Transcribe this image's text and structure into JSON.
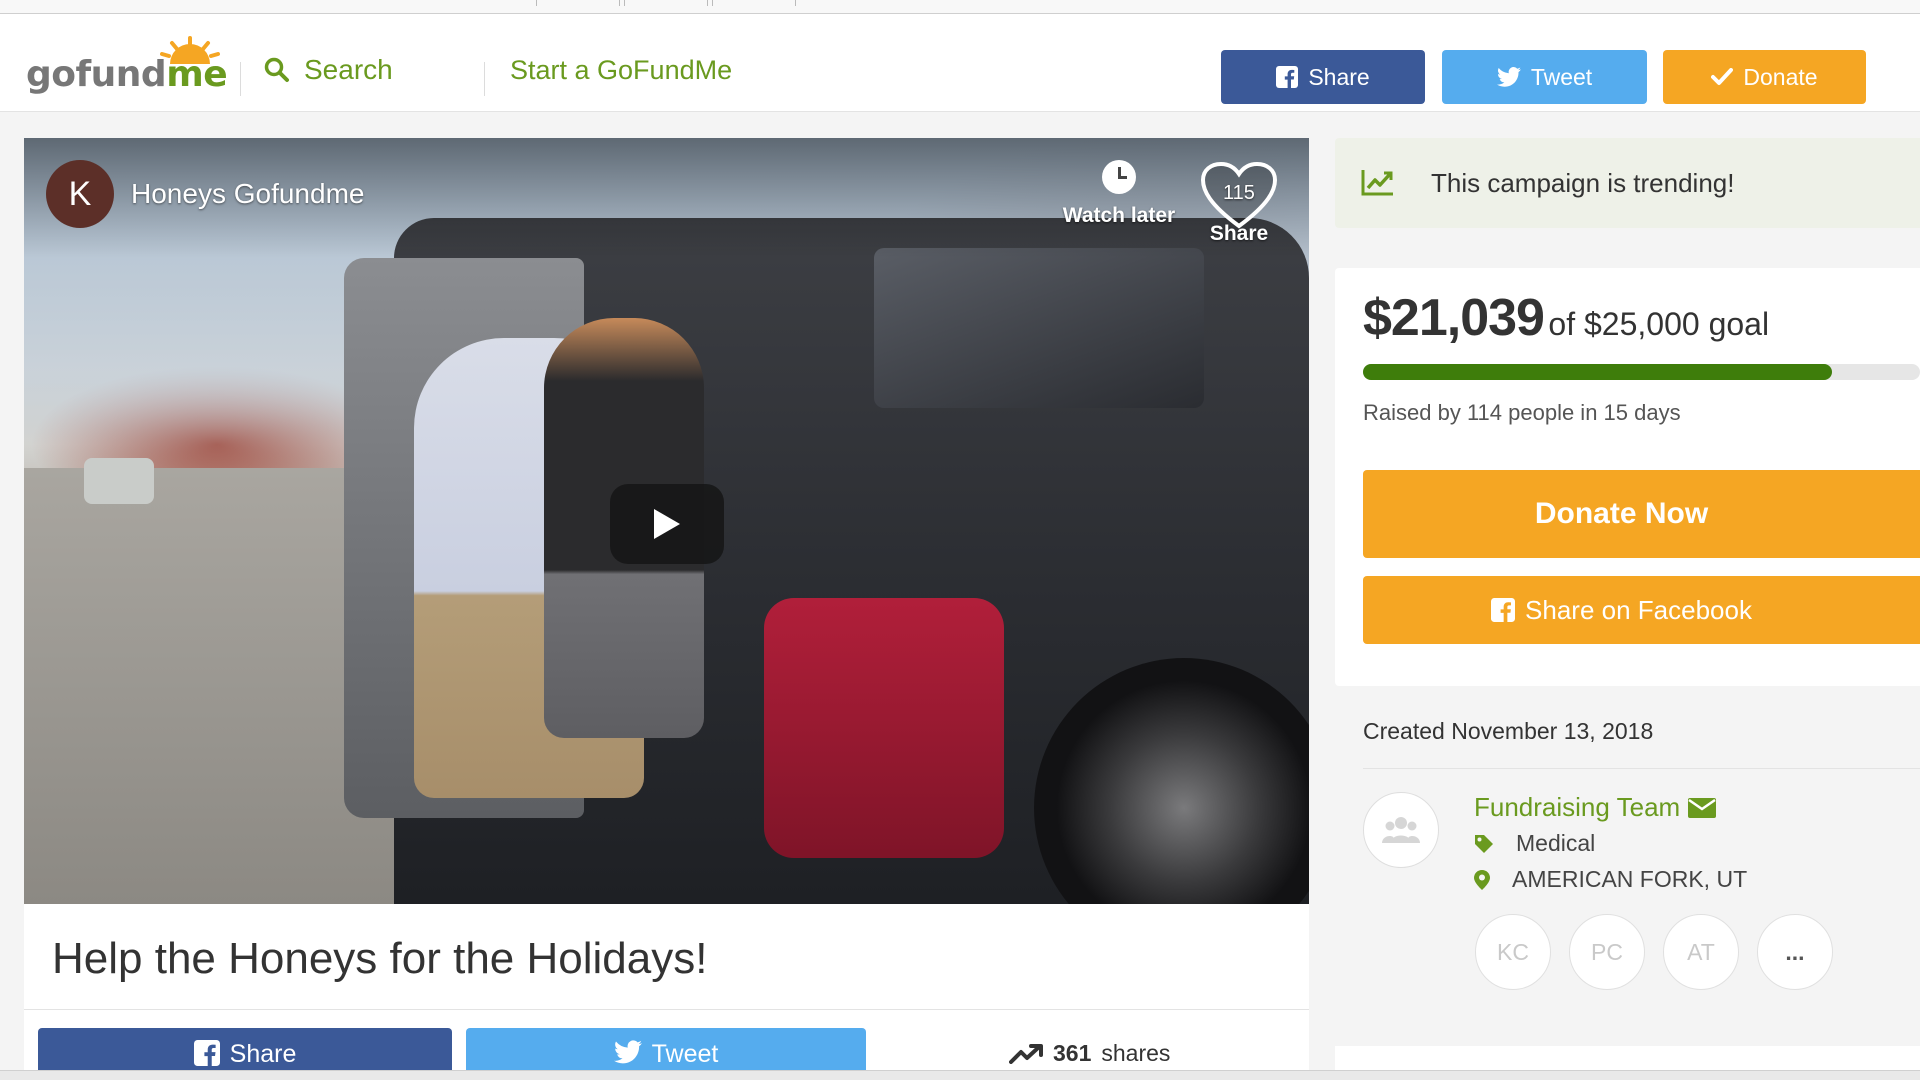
{
  "header": {
    "logo_text_a": "gofund",
    "logo_text_b": "me",
    "search_label": "Search",
    "start_label": "Start a GoFundMe",
    "share_label": "Share",
    "tweet_label": "Tweet",
    "donate_label": "Donate"
  },
  "video": {
    "channel_initial": "K",
    "channel_name": "Honeys Gofundme",
    "watch_later_label": "Watch later",
    "share_label": "Share",
    "share_count": "115"
  },
  "campaign": {
    "title": "Help the Honeys for the Holidays!",
    "share_label": "Share",
    "tweet_label": "Tweet",
    "shares_count": "361",
    "shares_suffix": "shares"
  },
  "sidebar": {
    "trending_text": "This campaign is trending!",
    "raised_amount": "$21,039",
    "goal_text": "of $25,000 goal",
    "progress_fraction": 0.8416,
    "raised_by_text": "Raised by 114 people in 15 days",
    "donate_now_label": "Donate Now",
    "share_facebook_label": "Share on Facebook",
    "created_text": "Created November 13, 2018",
    "team_name": "Fundraising Team",
    "category": "Medical",
    "location": "AMERICAN FORK, UT",
    "donors": [
      "KC",
      "PC",
      "AT",
      "..."
    ]
  },
  "colors": {
    "brand_green": "#6a9a1f",
    "facebook_blue": "#3b5998",
    "twitter_blue": "#55acee",
    "donate_orange": "#f5a623",
    "progress_green": "#3e7d0b"
  },
  "icons": [
    "search-icon",
    "facebook-icon",
    "twitter-icon",
    "check-icon",
    "clock-icon",
    "heart-icon",
    "play-icon",
    "trending-chart-icon",
    "envelope-icon",
    "tag-icon",
    "map-pin-icon",
    "people-icon",
    "trend-arrow-icon"
  ]
}
